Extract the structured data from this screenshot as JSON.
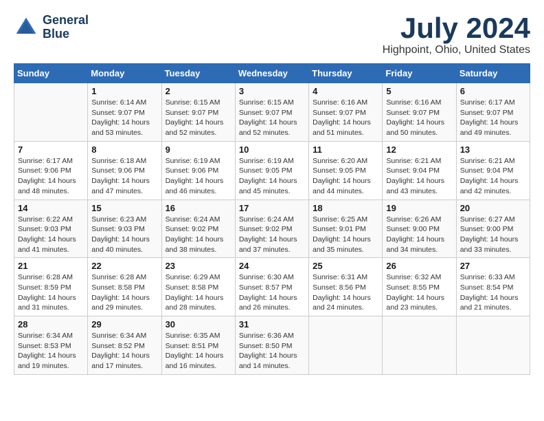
{
  "header": {
    "logo_line1": "General",
    "logo_line2": "Blue",
    "main_title": "July 2024",
    "subtitle": "Highpoint, Ohio, United States"
  },
  "calendar": {
    "headers": [
      "Sunday",
      "Monday",
      "Tuesday",
      "Wednesday",
      "Thursday",
      "Friday",
      "Saturday"
    ],
    "weeks": [
      [
        {
          "day": "",
          "info": ""
        },
        {
          "day": "1",
          "info": "Sunrise: 6:14 AM\nSunset: 9:07 PM\nDaylight: 14 hours\nand 53 minutes."
        },
        {
          "day": "2",
          "info": "Sunrise: 6:15 AM\nSunset: 9:07 PM\nDaylight: 14 hours\nand 52 minutes."
        },
        {
          "day": "3",
          "info": "Sunrise: 6:15 AM\nSunset: 9:07 PM\nDaylight: 14 hours\nand 52 minutes."
        },
        {
          "day": "4",
          "info": "Sunrise: 6:16 AM\nSunset: 9:07 PM\nDaylight: 14 hours\nand 51 minutes."
        },
        {
          "day": "5",
          "info": "Sunrise: 6:16 AM\nSunset: 9:07 PM\nDaylight: 14 hours\nand 50 minutes."
        },
        {
          "day": "6",
          "info": "Sunrise: 6:17 AM\nSunset: 9:07 PM\nDaylight: 14 hours\nand 49 minutes."
        }
      ],
      [
        {
          "day": "7",
          "info": "Sunrise: 6:17 AM\nSunset: 9:06 PM\nDaylight: 14 hours\nand 48 minutes."
        },
        {
          "day": "8",
          "info": "Sunrise: 6:18 AM\nSunset: 9:06 PM\nDaylight: 14 hours\nand 47 minutes."
        },
        {
          "day": "9",
          "info": "Sunrise: 6:19 AM\nSunset: 9:06 PM\nDaylight: 14 hours\nand 46 minutes."
        },
        {
          "day": "10",
          "info": "Sunrise: 6:19 AM\nSunset: 9:05 PM\nDaylight: 14 hours\nand 45 minutes."
        },
        {
          "day": "11",
          "info": "Sunrise: 6:20 AM\nSunset: 9:05 PM\nDaylight: 14 hours\nand 44 minutes."
        },
        {
          "day": "12",
          "info": "Sunrise: 6:21 AM\nSunset: 9:04 PM\nDaylight: 14 hours\nand 43 minutes."
        },
        {
          "day": "13",
          "info": "Sunrise: 6:21 AM\nSunset: 9:04 PM\nDaylight: 14 hours\nand 42 minutes."
        }
      ],
      [
        {
          "day": "14",
          "info": "Sunrise: 6:22 AM\nSunset: 9:03 PM\nDaylight: 14 hours\nand 41 minutes."
        },
        {
          "day": "15",
          "info": "Sunrise: 6:23 AM\nSunset: 9:03 PM\nDaylight: 14 hours\nand 40 minutes."
        },
        {
          "day": "16",
          "info": "Sunrise: 6:24 AM\nSunset: 9:02 PM\nDaylight: 14 hours\nand 38 minutes."
        },
        {
          "day": "17",
          "info": "Sunrise: 6:24 AM\nSunset: 9:02 PM\nDaylight: 14 hours\nand 37 minutes."
        },
        {
          "day": "18",
          "info": "Sunrise: 6:25 AM\nSunset: 9:01 PM\nDaylight: 14 hours\nand 35 minutes."
        },
        {
          "day": "19",
          "info": "Sunrise: 6:26 AM\nSunset: 9:00 PM\nDaylight: 14 hours\nand 34 minutes."
        },
        {
          "day": "20",
          "info": "Sunrise: 6:27 AM\nSunset: 9:00 PM\nDaylight: 14 hours\nand 33 minutes."
        }
      ],
      [
        {
          "day": "21",
          "info": "Sunrise: 6:28 AM\nSunset: 8:59 PM\nDaylight: 14 hours\nand 31 minutes."
        },
        {
          "day": "22",
          "info": "Sunrise: 6:28 AM\nSunset: 8:58 PM\nDaylight: 14 hours\nand 29 minutes."
        },
        {
          "day": "23",
          "info": "Sunrise: 6:29 AM\nSunset: 8:58 PM\nDaylight: 14 hours\nand 28 minutes."
        },
        {
          "day": "24",
          "info": "Sunrise: 6:30 AM\nSunset: 8:57 PM\nDaylight: 14 hours\nand 26 minutes."
        },
        {
          "day": "25",
          "info": "Sunrise: 6:31 AM\nSunset: 8:56 PM\nDaylight: 14 hours\nand 24 minutes."
        },
        {
          "day": "26",
          "info": "Sunrise: 6:32 AM\nSunset: 8:55 PM\nDaylight: 14 hours\nand 23 minutes."
        },
        {
          "day": "27",
          "info": "Sunrise: 6:33 AM\nSunset: 8:54 PM\nDaylight: 14 hours\nand 21 minutes."
        }
      ],
      [
        {
          "day": "28",
          "info": "Sunrise: 6:34 AM\nSunset: 8:53 PM\nDaylight: 14 hours\nand 19 minutes."
        },
        {
          "day": "29",
          "info": "Sunrise: 6:34 AM\nSunset: 8:52 PM\nDaylight: 14 hours\nand 17 minutes."
        },
        {
          "day": "30",
          "info": "Sunrise: 6:35 AM\nSunset: 8:51 PM\nDaylight: 14 hours\nand 16 minutes."
        },
        {
          "day": "31",
          "info": "Sunrise: 6:36 AM\nSunset: 8:50 PM\nDaylight: 14 hours\nand 14 minutes."
        },
        {
          "day": "",
          "info": ""
        },
        {
          "day": "",
          "info": ""
        },
        {
          "day": "",
          "info": ""
        }
      ]
    ]
  }
}
